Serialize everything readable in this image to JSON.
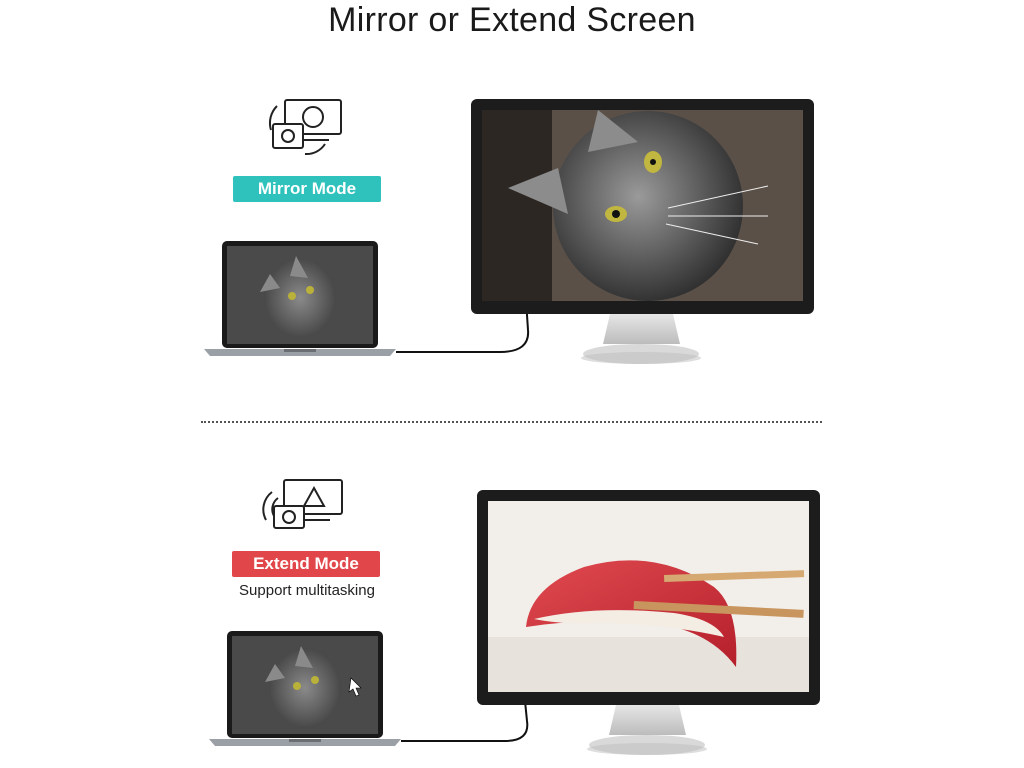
{
  "header": {
    "title": "Mirror or Extend Screen"
  },
  "mirror": {
    "badge_label": "Mirror Mode",
    "badge_color": "#2fc2bd",
    "icon": "mirror-display-icon"
  },
  "extend": {
    "badge_label": "Extend Mode",
    "badge_color": "#e1464a",
    "subtitle": "Support multitasking",
    "icon": "extend-display-icon"
  }
}
